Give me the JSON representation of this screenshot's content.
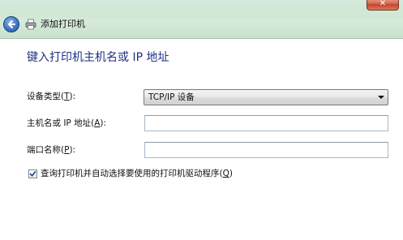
{
  "window": {
    "title": "添加打印机",
    "close_glyph": "✕"
  },
  "page": {
    "heading": "键入打印机主机名或 IP 地址"
  },
  "form": {
    "device_type": {
      "label_prefix": "设备类型(",
      "label_key": "T",
      "label_suffix": "):",
      "selected": "TCP/IP 设备"
    },
    "hostname": {
      "label_prefix": "主机名或 IP 地址(",
      "label_key": "A",
      "label_suffix": "):",
      "value": ""
    },
    "port": {
      "label_prefix": "端口名称(",
      "label_key": "P",
      "label_suffix": "):",
      "value": ""
    },
    "query_checkbox": {
      "checked": true,
      "label_prefix": "查询打印机并自动选择要使用的打印机驱动程序(",
      "label_key": "Q",
      "label_suffix": ")"
    }
  },
  "icons": {
    "back": "back-arrow-icon",
    "printer": "printer-icon",
    "close": "close-icon",
    "dropdown": "chevron-down-icon",
    "check": "checkmark-icon"
  },
  "colors": {
    "heading": "#1e3287",
    "titlebar": "#cde6d2",
    "close_button": "#c2462c",
    "back_button": "#3f76c4"
  }
}
